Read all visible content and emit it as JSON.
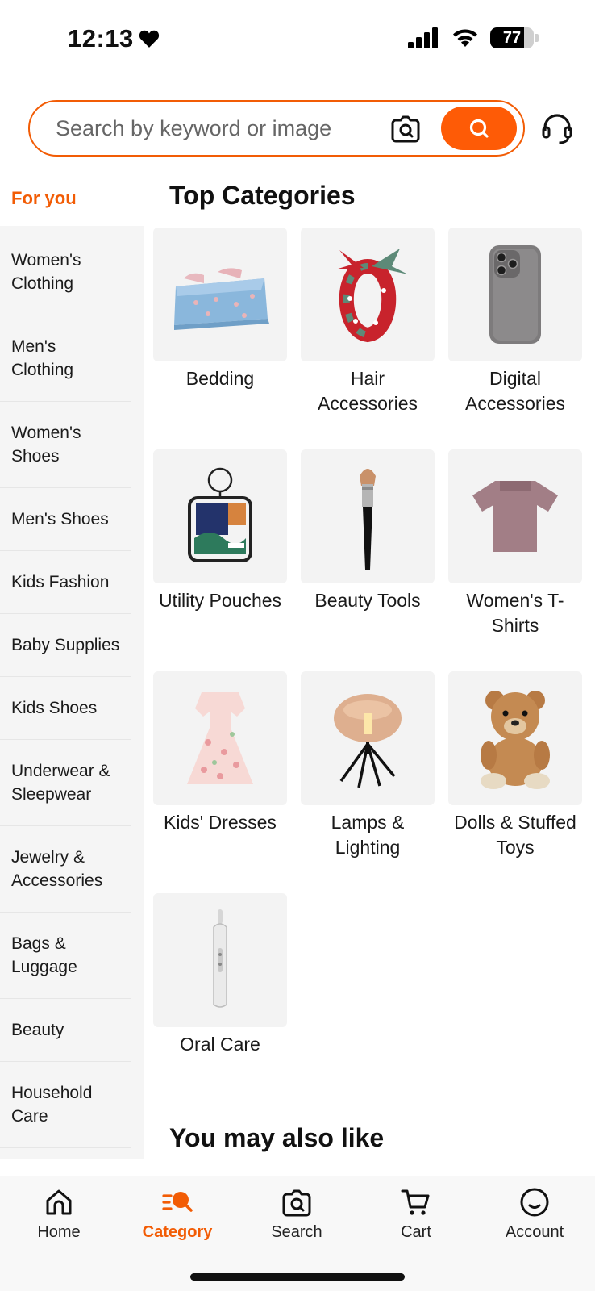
{
  "status_bar": {
    "time": "12:13",
    "battery": "77",
    "battery_level": 0.77
  },
  "search": {
    "placeholder": "Search by keyword or image"
  },
  "sidebar": {
    "for_you": "For you",
    "items": [
      {
        "label": "Women's Clothing"
      },
      {
        "label": "Men's Clothing"
      },
      {
        "label": "Women's Shoes"
      },
      {
        "label": "Men's Shoes"
      },
      {
        "label": "Kids Fashion"
      },
      {
        "label": "Baby Supplies"
      },
      {
        "label": "Kids Shoes"
      },
      {
        "label": "Underwear & Sleepwear"
      },
      {
        "label": "Jewelry & Accessories"
      },
      {
        "label": "Bags & Luggage"
      },
      {
        "label": "Beauty"
      },
      {
        "label": "Household Care"
      }
    ]
  },
  "main": {
    "top_title": "Top Categories",
    "categories": [
      {
        "label": "Bedding",
        "icon": "bedding-icon"
      },
      {
        "label": "Hair Accessories",
        "icon": "scarf-icon"
      },
      {
        "label": "Digital Accessories",
        "icon": "phone-case-icon"
      },
      {
        "label": "Utility Pouches",
        "icon": "pouch-icon"
      },
      {
        "label": "Beauty Tools",
        "icon": "makeup-brush-icon"
      },
      {
        "label": "Women's T-Shirts",
        "icon": "tshirt-icon"
      },
      {
        "label": "Kids' Dresses",
        "icon": "dress-icon"
      },
      {
        "label": "Lamps & Lighting",
        "icon": "lamp-icon"
      },
      {
        "label": "Dolls & Stuffed Toys",
        "icon": "teddy-bear-icon"
      },
      {
        "label": "Oral Care",
        "icon": "toothbrush-icon"
      }
    ],
    "also_title": "You may also like"
  },
  "nav": {
    "home": "Home",
    "category": "Category",
    "search": "Search",
    "cart": "Cart",
    "account": "Account"
  },
  "colors": {
    "accent": "#f25c05",
    "sidebar_bg": "#f5f5f5"
  }
}
